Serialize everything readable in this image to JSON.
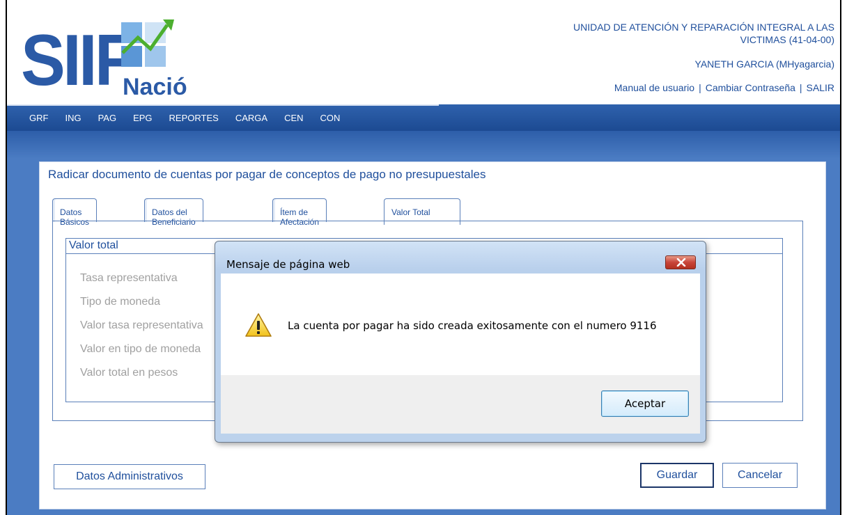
{
  "header": {
    "logo_text": "SIIF",
    "logo_subtext": "Nación",
    "org_name_line1": "UNIDAD DE ATENCIÓN Y REPARACIÓN INTEGRAL A LAS",
    "org_name_line2": "VICTIMAS (41-04-00)",
    "user": "YANETH GARCIA (MHyagarcia)",
    "links": [
      "Manual de usuario",
      "Cambiar Contraseña",
      "SALIR"
    ]
  },
  "nav": {
    "items": [
      "GRF",
      "ING",
      "PAG",
      "EPG",
      "REPORTES",
      "CARGA",
      "CEN",
      "CON"
    ]
  },
  "page": {
    "title": "Radicar documento de cuentas por pagar de conceptos de pago no presupuestales",
    "tabs": [
      "Datos Básicos",
      "Datos del Beneficiario",
      "Ítem de Afectación",
      "Valor Total"
    ],
    "active_tab": "Valor Total",
    "section_title": "Valor total",
    "fields": [
      "Tasa representativa",
      "Tipo de moneda",
      "Valor tasa representativa",
      "Valor en tipo de moneda",
      "Valor total en pesos"
    ],
    "buttons": {
      "admin": "Datos Administrativos",
      "save": "Guardar",
      "cancel": "Cancelar"
    }
  },
  "dialog": {
    "title": "Mensaje de página web",
    "message": "La cuenta por pagar ha sido creada exitosamente con el numero 9116",
    "ok_label": "Aceptar",
    "icon": "warning-icon"
  },
  "colors": {
    "brand_blue": "#1f4f9c",
    "nav_blue": "#2f62ad",
    "background_blue": "#4b7cc3"
  }
}
